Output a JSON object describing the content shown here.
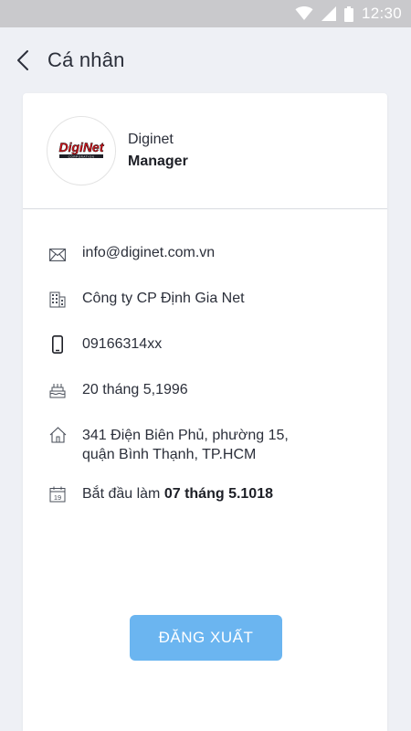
{
  "status_bar": {
    "time": "12:30",
    "icons": [
      "wifi-icon",
      "signal-icon",
      "battery-icon"
    ]
  },
  "header": {
    "back_icon": "chevron-left-icon",
    "title": "Cá nhân"
  },
  "profile": {
    "logo_text_main": "DigiNet",
    "logo_text_sub": "CORPORATION",
    "name": "Diginet",
    "role": "Manager"
  },
  "info": {
    "email": "info@diginet.com.vn",
    "company": "Công ty CP Định Gia Net",
    "phone": "09166314xx",
    "birthday": "20 tháng 5,1996",
    "address_line1": "341 Điện Biên Phủ, phường 15,",
    "address_line2": "quận Bình Thạnh, TP.HCM",
    "start_prefix": "Bắt đầu làm ",
    "start_date": "07 tháng 5.1018",
    "calendar_day": "19"
  },
  "logout_label": "ĐĂNG XUẤT",
  "colors": {
    "background": "#eef0f5",
    "status_bar": "#c9c9cc",
    "button": "#6bb5f0",
    "logo_red": "#d4141c"
  }
}
